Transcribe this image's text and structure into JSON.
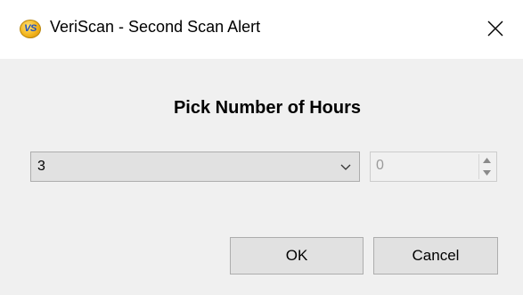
{
  "window": {
    "title": "VeriScan - Second Scan Alert",
    "app_icon": {
      "name": "veriscan-logo-icon",
      "text": "VS"
    },
    "close_icon": "close-icon"
  },
  "dialog": {
    "heading": "Pick Number of Hours",
    "hours_select": {
      "value": "3",
      "icon": "chevron-down-icon"
    },
    "minutes_spinner": {
      "value": "0",
      "up_icon": "spin-up-icon",
      "down_icon": "spin-down-icon"
    },
    "ok_label": "OK",
    "cancel_label": "Cancel"
  },
  "colors": {
    "titlebar_bg": "#ffffff",
    "dialog_bg": "#f0f0f0",
    "button_bg": "#e1e1e1",
    "button_border": "#adadad",
    "disabled_text": "#9a9a9a"
  }
}
